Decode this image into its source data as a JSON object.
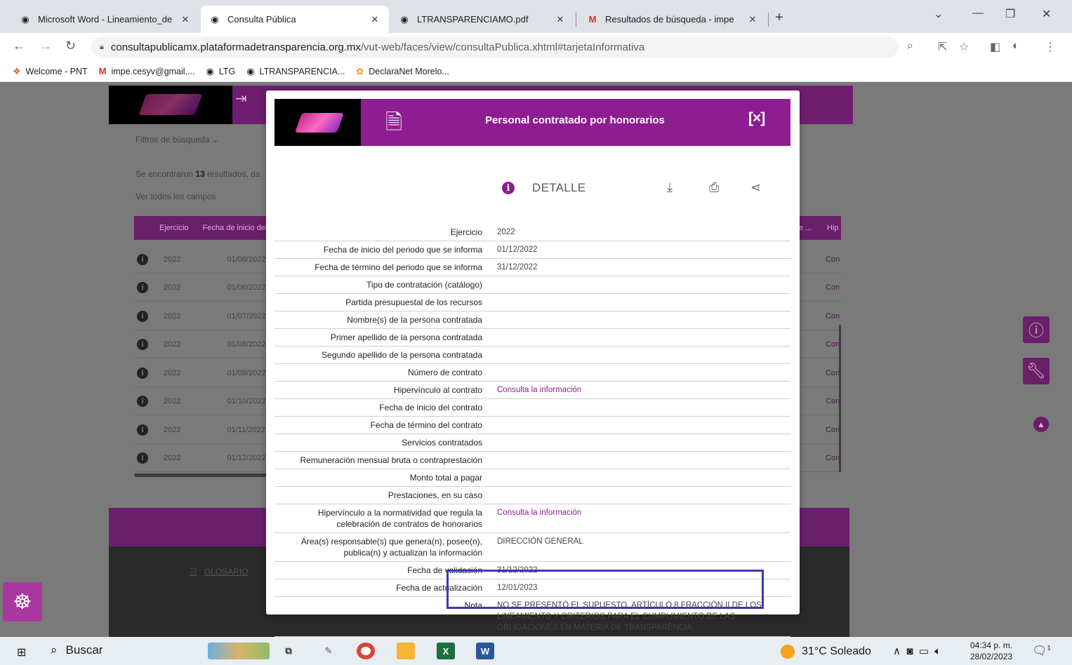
{
  "browser": {
    "tabs": [
      {
        "title": "Microsoft Word - Lineamiento_de",
        "icon": "globe-icon"
      },
      {
        "title": "Consulta Pública",
        "icon": "globe-icon"
      },
      {
        "title": "LTRANSPARENCIAMO.pdf",
        "icon": "globe-icon"
      },
      {
        "title": "Resultados de búsqueda - impe",
        "icon": "gmail-icon"
      }
    ],
    "new_tab": "+",
    "url_domain": "consultapublicamx.plataformadetransparencia.org.mx",
    "url_path": "/vut-web/faces/view/consultaPublica.xhtml#tarjetaInformativa",
    "bookmarks": [
      {
        "label": "Welcome - PNT",
        "icon": "pnt-icon"
      },
      {
        "label": "impe.cesyv@gmail....",
        "icon": "gmail-icon"
      },
      {
        "label": "LTG",
        "icon": "globe-icon"
      },
      {
        "label": "LTRANSPARENCIA...",
        "icon": "globe-icon"
      },
      {
        "label": "DeclaraNet Morelo...",
        "icon": "declaranet-icon"
      }
    ]
  },
  "page": {
    "filters_label": "Filtros de búsqueda ⌄",
    "results_prefix": "Se encontraron ",
    "results_count": "13",
    "results_suffix": " resultados, da",
    "view_all": "Ver todos los campos",
    "table_headers": [
      "Ejercicio",
      "Fecha de inicio del"
    ],
    "header_right": [
      "e ...",
      "Hip"
    ],
    "rows": [
      {
        "year": "2022",
        "date": "01/06/2022",
        "link": "Con"
      },
      {
        "year": "2022",
        "date": "01/06/2022",
        "link": "Con"
      },
      {
        "year": "2022",
        "date": "01/07/2022",
        "link": "Con"
      },
      {
        "year": "2022",
        "date": "01/08/2022",
        "link": "Con"
      },
      {
        "year": "2022",
        "date": "01/09/2022",
        "link": "Con"
      },
      {
        "year": "2022",
        "date": "01/10/2022",
        "link": "Con"
      },
      {
        "year": "2022",
        "date": "01/11/2022",
        "link": "Con"
      },
      {
        "year": "2022",
        "date": "01/12/2022",
        "link": "Con"
      }
    ],
    "glosario": "GLOSARIO"
  },
  "modal": {
    "title": "Personal contratado por honorarios",
    "close": "[×]",
    "detail_label": "DETALLE",
    "fields": [
      {
        "key": "Ejercicio",
        "value": "2022"
      },
      {
        "key": "Fecha de inicio del periodo que se informa",
        "value": "01/12/2022"
      },
      {
        "key": "Fecha de término del periodo que se informa",
        "value": "31/12/2022"
      },
      {
        "key": "Tipo de contratación (catálogo)",
        "value": ""
      },
      {
        "key": "Partida presupuestal de los recursos",
        "value": ""
      },
      {
        "key": "Nombre(s) de la persona contratada",
        "value": ""
      },
      {
        "key": "Primer apellido de la persona contratada",
        "value": ""
      },
      {
        "key": "Segundo apellido de la persona contratada",
        "value": ""
      },
      {
        "key": "Número de contrato",
        "value": ""
      },
      {
        "key": "Hipervínculo al contrato",
        "value": "Consulta la información"
      },
      {
        "key": "Fecha de inicio del contrato",
        "value": ""
      },
      {
        "key": "Fecha de término del contrato",
        "value": ""
      },
      {
        "key": "Servicios contratados",
        "value": ""
      },
      {
        "key": "Remuneración mensual bruta o contraprestación",
        "value": ""
      },
      {
        "key": "Monto total a pagar",
        "value": ""
      },
      {
        "key": "Prestaciones, en su caso",
        "value": ""
      },
      {
        "key": "Hipervínculo a la normatividad que regula la celebración de contratos de honorarios",
        "value": "Consulta la información"
      },
      {
        "key": "Área(s) responsable(s) que genera(n), posee(n), publica(n) y actualizan la información",
        "value": "DIRECCIÓN GENERAL"
      },
      {
        "key": "Fecha de validación",
        "value": "31/12/2022"
      },
      {
        "key": "Fecha de actualización",
        "value": "12/01/2023"
      },
      {
        "key": "Nota",
        "value": "NO SE PRESENTÓ EL SUPUESTO. ARTÍCULO 8 FRACCIÓN II DE LOS LINEAMIENTO Y CRITERIOS PARA EL CUMPLIMIENTO DE LAS OBLIGACIONES EN MATERIA DE TRANSPARENCIA."
      }
    ],
    "link_fields": [
      9,
      16
    ]
  },
  "taskbar": {
    "search_label": "Buscar",
    "weather": "31°C Soleado",
    "time": "04:34 p. m.",
    "date": "28/02/2023",
    "notifications": "1"
  },
  "colors": {
    "brand_purple": "#8e1d92",
    "highlight_box": "#3a3ab5"
  }
}
